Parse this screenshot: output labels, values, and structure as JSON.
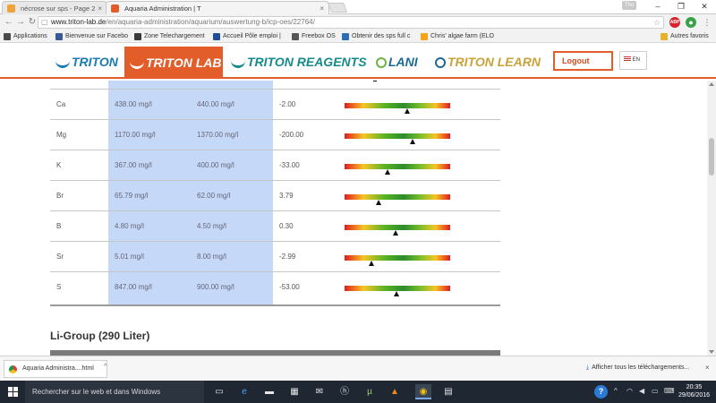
{
  "browser": {
    "tabs": [
      {
        "title": "nécrose sur sps - Page 2",
        "favicon_color": "#f0a23a"
      },
      {
        "title": "Aquaria Administration | T",
        "favicon_color": "#e25d2a"
      }
    ],
    "user_badge": "Tho",
    "url_host": "www.triton-lab.de",
    "url_path": "/en/aquaria-administration/aquarium/auswertung-b/icp-oes/22764/",
    "bookmarks": [
      {
        "label": "Applications",
        "icon_color": "#4a4a4a"
      },
      {
        "label": "Bienvenue sur Facebo",
        "icon_color": "#3b5998"
      },
      {
        "label": "Zone Telechargement",
        "icon_color": "#3a3a3a"
      },
      {
        "label": "Accueil Pôle emploi |",
        "icon_color": "#1f4e9a"
      },
      {
        "label": "Freebox OS",
        "icon_color": "#555555"
      },
      {
        "label": "Obtenir des sps full c",
        "icon_color": "#2d6db5"
      },
      {
        "label": "Chris' algae farm (ELO",
        "icon_color": "#f3a417"
      },
      {
        "label": "Autres favoris",
        "icon_color": "#e6b22c"
      }
    ]
  },
  "site": {
    "brands": [
      "TRITON",
      "TRITON LAB",
      "TRITON REAGENTS",
      "LANI",
      "TRITON LEARN"
    ],
    "logout_label": "Logout",
    "language": "EN",
    "accent_color": "#e25d2a"
  },
  "results": {
    "rows": [
      {
        "element": "Ca",
        "actual": "438.00 mg/l",
        "setpoint": "440.00 mg/l",
        "deviation": "-2.00",
        "marker_pct": 59
      },
      {
        "element": "Mg",
        "actual": "1170.00 mg/l",
        "setpoint": "1370.00 mg/l",
        "deviation": "-200.00",
        "marker_pct": 64
      },
      {
        "element": "K",
        "actual": "367.00 mg/l",
        "setpoint": "400.00 mg/l",
        "deviation": "-33.00",
        "marker_pct": 41
      },
      {
        "element": "Br",
        "actual": "65.79 mg/l",
        "setpoint": "62.00 mg/l",
        "deviation": "3.79",
        "marker_pct": 32
      },
      {
        "element": "B",
        "actual": "4.80 mg/l",
        "setpoint": "4.50 mg/l",
        "deviation": "0.30",
        "marker_pct": 48
      },
      {
        "element": "Sr",
        "actual": "5.01 mg/l",
        "setpoint": "8.00 mg/l",
        "deviation": "-2.99",
        "marker_pct": 25
      },
      {
        "element": "S",
        "actual": "847.00 mg/l",
        "setpoint": "900.00 mg/l",
        "deviation": "-53.00",
        "marker_pct": 49
      }
    ],
    "next_group_title": "Li-Group (290 Liter)"
  },
  "downloads": {
    "item_name": "Aquaria Administra....html",
    "show_all_label": "Afficher tous les téléchargements..."
  },
  "taskbar": {
    "search_placeholder": "Rechercher sur le web et dans Windows",
    "time": "20:35",
    "date": "29/06/2016"
  }
}
